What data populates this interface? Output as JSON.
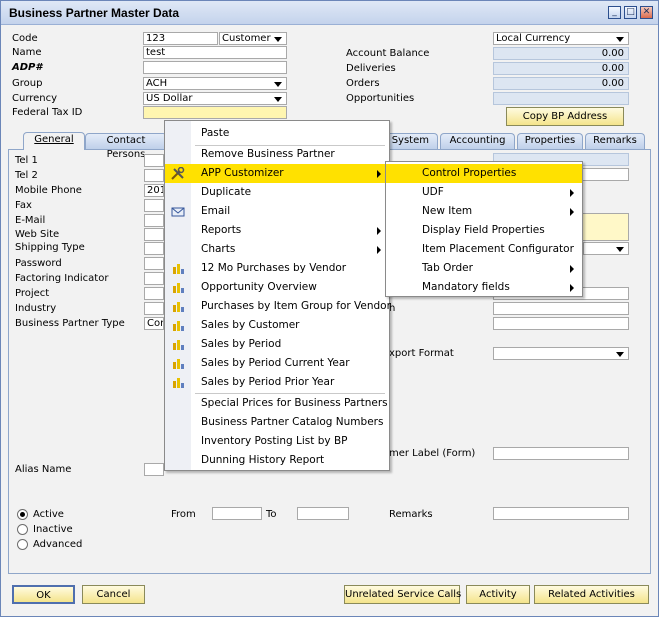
{
  "window": {
    "title": "Business Partner Master Data"
  },
  "header": {
    "code_label": "Code",
    "code_value": "123",
    "type_value": "Customer",
    "name_label": "Name",
    "name_value": "test",
    "adp_label": "ADP#",
    "group_label": "Group",
    "group_value": "ACH",
    "currency_label": "Currency",
    "currency_value": "US Dollar",
    "tax_label": "Federal Tax ID",
    "local_currency": "Local Currency",
    "balance_label": "Account Balance",
    "balance_value": "0.00",
    "deliveries_label": "Deliveries",
    "deliveries_value": "0.00",
    "orders_label": "Orders",
    "orders_value": "0.00",
    "opps_label": "Opportunities",
    "copy_button": "Copy BP Address"
  },
  "tabs": [
    "General",
    "Contact Persons",
    "t System",
    "Accounting",
    "Properties",
    "Remarks"
  ],
  "general": {
    "labels": [
      "Tel 1",
      "Tel 2",
      "Mobile Phone",
      "Fax",
      "E-Mail",
      "Web Site",
      "Shipping Type",
      "Password",
      "Factoring Indicator",
      "Project",
      "Industry",
      "Business Partner Type"
    ],
    "mobile_value": "2014",
    "bptype_value": "Con",
    "alias_label": "Alias Name",
    "right_partial": [
      "h",
      "xport Format",
      "mer Label (Form)"
    ],
    "active": "Active",
    "inactive": "Inactive",
    "advanced": "Advanced",
    "from": "From",
    "to": "To",
    "remarks": "Remarks"
  },
  "footer": {
    "ok": "OK",
    "cancel": "Cancel",
    "unrelated": "Unrelated Service Calls",
    "activity": "Activity",
    "related": "Related Activities"
  },
  "context_menu": {
    "items": [
      "Paste",
      "Remove Business Partner",
      "APP Customizer",
      "Duplicate",
      "Email",
      "Reports",
      "Charts",
      "12 Mo Purchases by Vendor",
      "Opportunity Overview",
      "Purchases by Item Group for Vendor",
      "Sales by Customer",
      "Sales by Period",
      "Sales by Period Current Year",
      "Sales by Period Prior Year",
      "Special Prices for Business Partners",
      "Business Partner Catalog Numbers",
      "Inventory Posting List by BP",
      "Dunning History Report"
    ]
  },
  "submenu": {
    "items": [
      "Control Properties",
      "UDF",
      "New Item",
      "Display Field Properties",
      "Item Placement Configurator",
      "Tab Order",
      "Mandatory fields"
    ]
  },
  "colors": {
    "highlight": "#ffe100",
    "button_face": "#f4e48c",
    "title_bar": "#c4d3ec"
  }
}
